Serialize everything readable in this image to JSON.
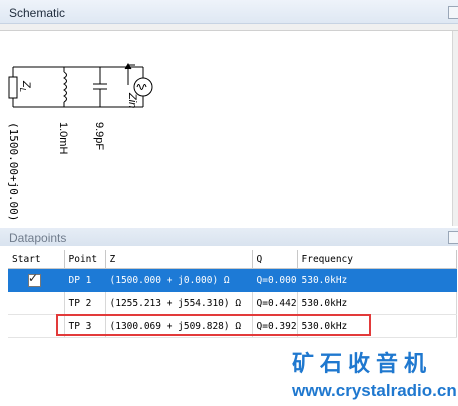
{
  "schematic": {
    "title": "Schematic",
    "components": [
      {
        "symbol": "Z",
        "subscript": "L",
        "value": "(1500.00+j0.00)"
      },
      {
        "symbol": "inductor",
        "value": "1.0mH"
      },
      {
        "symbol": "capacitor",
        "value": "9.9pF"
      },
      {
        "symbol": "Zin",
        "value": "source-icon"
      }
    ]
  },
  "datapoints": {
    "title": "Datapoints",
    "columns": [
      "Start",
      "Point",
      "Z",
      "Q",
      "Frequency"
    ],
    "rows": [
      {
        "start": "✓",
        "point": "DP 1",
        "z": "(1500.000 + j0.000)  Ω",
        "q": "Q=0.000",
        "freq": "530.0kHz"
      },
      {
        "start": "",
        "point": "TP 2",
        "z": "(1255.213 + j554.310)  Ω",
        "q": "Q=0.442",
        "freq": "530.0kHz"
      },
      {
        "start": "",
        "point": "TP 3",
        "z": "(1300.069 + j509.828)  Ω",
        "q": "Q=0.392",
        "freq": "530.0kHz"
      }
    ]
  },
  "watermark": {
    "cn": "矿石收音机",
    "url": "www.crystalradio.cn"
  },
  "colors": {
    "selection": "#1d7ad6",
    "highlight_box": "#e23a3a",
    "watermark": "#1f78cf"
  }
}
